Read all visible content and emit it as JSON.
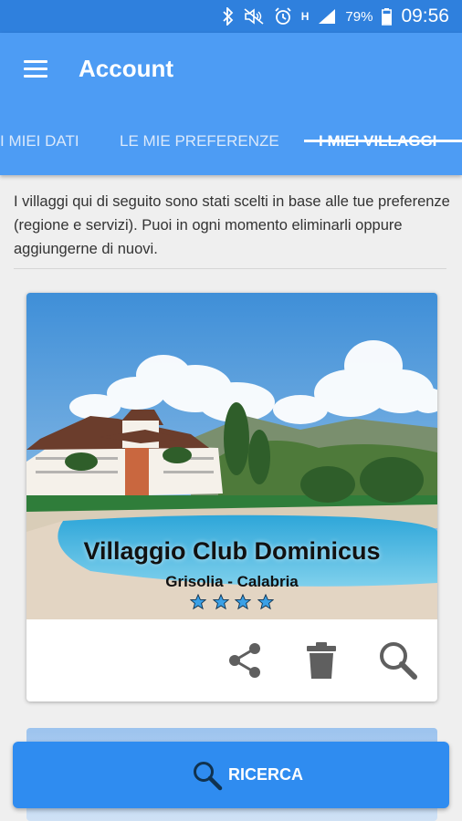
{
  "status": {
    "battery": "79%",
    "time": "09:56",
    "network": "H"
  },
  "appbar": {
    "title": "Account"
  },
  "tabs": [
    {
      "label": "I MIEI DATI"
    },
    {
      "label": "LE MIE PREFERENZE"
    },
    {
      "label": "I MIEI VILLAGGI",
      "active": true
    }
  ],
  "intro": "I villaggi qui di seguito sono stati scelti in base alle tue preferenze (regione e servizi). Puoi in ogni momento eliminarli oppure aggiungerne di nuovi.",
  "card": {
    "name": "Villaggio Club Dominicus",
    "location": "Grisolia - Calabria",
    "stars": 4,
    "actions": [
      "share-icon",
      "trash-icon",
      "search-icon"
    ]
  },
  "fab": {
    "label": "RICERCA"
  },
  "colors": {
    "statusbar": "#2f80dd",
    "appbar": "#4d9cf4",
    "fab": "#2f8cf0",
    "star": "#3aa0e6"
  }
}
